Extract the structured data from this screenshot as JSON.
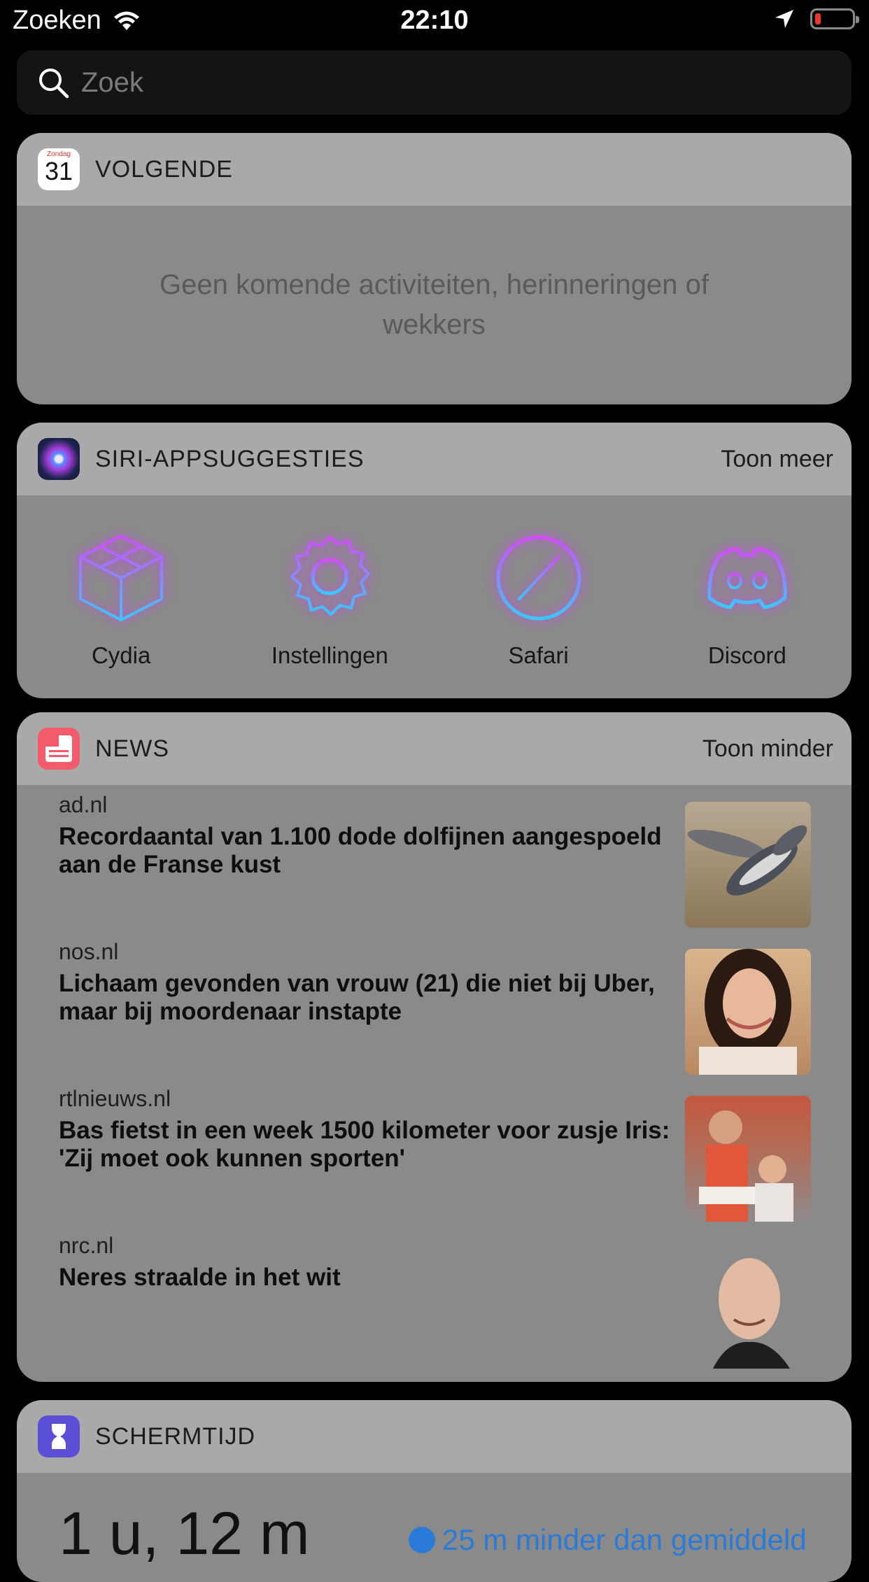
{
  "status_bar": {
    "carrier": "Zoeken",
    "time": "22:10",
    "battery_level": 0.15
  },
  "search": {
    "placeholder": "Zoek"
  },
  "widgets": {
    "next": {
      "icon_day": "Zondag",
      "icon_date": "31",
      "title": "VOLGENDE",
      "empty_message": "Geen komende activiteiten, herinneringen of wekkers"
    },
    "siri": {
      "title": "SIRI-APPSUGGESTIES",
      "action": "Toon meer",
      "apps": [
        {
          "label": "Cydia",
          "icon": "cydia-icon"
        },
        {
          "label": "Instellingen",
          "icon": "settings-icon"
        },
        {
          "label": "Safari",
          "icon": "safari-icon"
        },
        {
          "label": "Discord",
          "icon": "discord-icon"
        }
      ]
    },
    "news": {
      "title": "NEWS",
      "action": "Toon minder",
      "items": [
        {
          "source": "ad.nl",
          "headline": "Recordaantal van 1.100 dode dolfijnen aangespoeld aan de Franse kust"
        },
        {
          "source": "nos.nl",
          "headline": "Lichaam gevonden van vrouw (21) die niet bij Uber, maar bij moordenaar instapte"
        },
        {
          "source": "rtlnieuws.nl",
          "headline": "Bas fietst in een week 1500 kilometer voor zusje Iris: 'Zij moet ook kunnen sporten'"
        },
        {
          "source": "nrc.nl",
          "headline": "Neres straalde in het wit"
        }
      ]
    },
    "screen_time": {
      "title": "SCHERMTIJD",
      "total": "1 u, 12 m",
      "comparison": "25 m minder dan gemiddeld"
    }
  }
}
